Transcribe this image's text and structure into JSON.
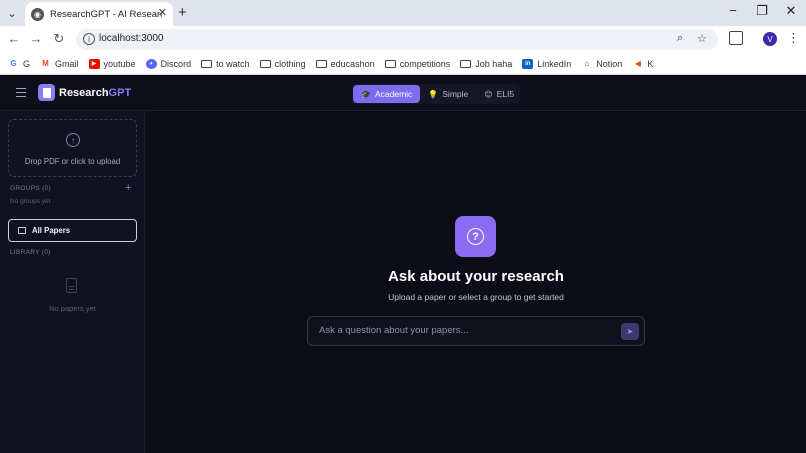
{
  "browser": {
    "tab_title": "ResearchGPT - AI Research Pap",
    "url": "localhost:3000",
    "profile_initial": "V",
    "bookmarks": [
      {
        "label": "G",
        "icon": "google-icon"
      },
      {
        "label": "Gmail",
        "icon": "gmail-icon"
      },
      {
        "label": "youtube",
        "icon": "youtube-icon"
      },
      {
        "label": "Discord",
        "icon": "discord-icon"
      },
      {
        "label": "to watch",
        "icon": "folder-icon"
      },
      {
        "label": "clothing",
        "icon": "folder-icon"
      },
      {
        "label": "educashon",
        "icon": "folder-icon"
      },
      {
        "label": "competitions",
        "icon": "folder-icon"
      },
      {
        "label": "Job haha",
        "icon": "folder-icon"
      },
      {
        "label": "LinkedIn",
        "icon": "linkedin-icon"
      },
      {
        "label": "Notion",
        "icon": "notion-icon"
      },
      {
        "label": "K",
        "icon": "k-icon"
      }
    ]
  },
  "header": {
    "brand_main": "Research",
    "brand_accent": "GPT",
    "modes": [
      {
        "label": "Academic",
        "icon": "graduation-cap-icon"
      },
      {
        "label": "Simple",
        "icon": "lightbulb-icon"
      },
      {
        "label": "ELI5",
        "icon": "emoji-icon"
      }
    ],
    "active_mode": "Academic"
  },
  "sidebar": {
    "dropzone_text": "Drop PDF or click to upload",
    "groups_label": "GROUPS (0)",
    "groups_empty": "No groups yet",
    "all_papers_label": "All Papers",
    "library_label": "LIBRARY (0)",
    "library_empty": "No papers yet"
  },
  "main": {
    "title": "Ask about your research",
    "subtitle": "Upload a paper or select a group to get started",
    "input_placeholder": "Ask a question about your papers..."
  },
  "colors": {
    "accent": "#8b7cf6",
    "background": "#0d0d17",
    "sidebar": "#111120"
  }
}
